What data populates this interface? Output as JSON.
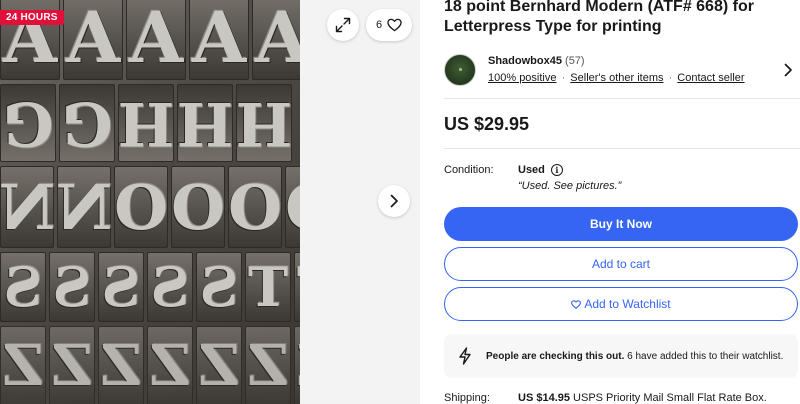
{
  "gallery": {
    "badge": "24 HOURS",
    "watch_count": "6",
    "letters": {
      "row1": [
        "A",
        "A",
        "A",
        "A",
        "A"
      ],
      "row2": [
        "G",
        "G",
        "H",
        "H",
        "H"
      ],
      "row3": [
        "N",
        "N",
        "O",
        "O",
        "O",
        "O"
      ],
      "row4": [
        "S",
        "S",
        "S",
        "S",
        "S",
        "T",
        "T"
      ],
      "row5": [
        "Z",
        "Z",
        "Z",
        "Z",
        "Z",
        "Z",
        "Z"
      ]
    }
  },
  "listing": {
    "title": "18 point Bernhard Modern (ATF# 668) for Letterpress Type for printing",
    "seller": {
      "name": "Shadowbox45",
      "feedback_count": "(57)",
      "positive": "100% positive",
      "other_items": "Seller's other items",
      "contact": "Contact seller"
    },
    "price": "US $29.95",
    "condition": {
      "label": "Condition:",
      "value": "Used",
      "note": "“Used. See pictures.”"
    },
    "buttons": {
      "buy_now": "Buy It Now",
      "add_to_cart": "Add to cart",
      "watchlist": "Add to Watchlist"
    },
    "notice": {
      "bold": "People are checking this out.",
      "rest": " 6 have added this to their watchlist."
    },
    "shipping": {
      "label": "Shipping:",
      "price": "US $14.95",
      "method": " USPS Priority Mail Small Flat Rate Box."
    }
  },
  "colors": {
    "accent": "#3665f3",
    "badge": "#e0103a"
  }
}
